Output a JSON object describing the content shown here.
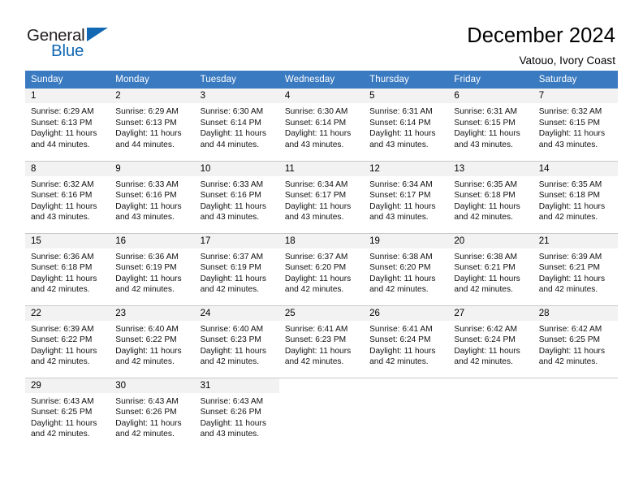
{
  "logo": {
    "word_general": "General",
    "word_blue": "Blue",
    "triangle_color": "#1268b3"
  },
  "header": {
    "title": "December 2024",
    "subtitle": "Vatouo, Ivory Coast"
  },
  "theme": {
    "header_row_bg": "#3a7ac0",
    "daynum_bg": "#f2f2f2",
    "grid_line": "#c9c9c9",
    "text": "#000000"
  },
  "weekdays": [
    "Sunday",
    "Monday",
    "Tuesday",
    "Wednesday",
    "Thursday",
    "Friday",
    "Saturday"
  ],
  "weeks": [
    [
      {
        "day": "1",
        "sunrise": "Sunrise: 6:29 AM",
        "sunset": "Sunset: 6:13 PM",
        "daylight1": "Daylight: 11 hours",
        "daylight2": "and 44 minutes."
      },
      {
        "day": "2",
        "sunrise": "Sunrise: 6:29 AM",
        "sunset": "Sunset: 6:13 PM",
        "daylight1": "Daylight: 11 hours",
        "daylight2": "and 44 minutes."
      },
      {
        "day": "3",
        "sunrise": "Sunrise: 6:30 AM",
        "sunset": "Sunset: 6:14 PM",
        "daylight1": "Daylight: 11 hours",
        "daylight2": "and 44 minutes."
      },
      {
        "day": "4",
        "sunrise": "Sunrise: 6:30 AM",
        "sunset": "Sunset: 6:14 PM",
        "daylight1": "Daylight: 11 hours",
        "daylight2": "and 43 minutes."
      },
      {
        "day": "5",
        "sunrise": "Sunrise: 6:31 AM",
        "sunset": "Sunset: 6:14 PM",
        "daylight1": "Daylight: 11 hours",
        "daylight2": "and 43 minutes."
      },
      {
        "day": "6",
        "sunrise": "Sunrise: 6:31 AM",
        "sunset": "Sunset: 6:15 PM",
        "daylight1": "Daylight: 11 hours",
        "daylight2": "and 43 minutes."
      },
      {
        "day": "7",
        "sunrise": "Sunrise: 6:32 AM",
        "sunset": "Sunset: 6:15 PM",
        "daylight1": "Daylight: 11 hours",
        "daylight2": "and 43 minutes."
      }
    ],
    [
      {
        "day": "8",
        "sunrise": "Sunrise: 6:32 AM",
        "sunset": "Sunset: 6:16 PM",
        "daylight1": "Daylight: 11 hours",
        "daylight2": "and 43 minutes."
      },
      {
        "day": "9",
        "sunrise": "Sunrise: 6:33 AM",
        "sunset": "Sunset: 6:16 PM",
        "daylight1": "Daylight: 11 hours",
        "daylight2": "and 43 minutes."
      },
      {
        "day": "10",
        "sunrise": "Sunrise: 6:33 AM",
        "sunset": "Sunset: 6:16 PM",
        "daylight1": "Daylight: 11 hours",
        "daylight2": "and 43 minutes."
      },
      {
        "day": "11",
        "sunrise": "Sunrise: 6:34 AM",
        "sunset": "Sunset: 6:17 PM",
        "daylight1": "Daylight: 11 hours",
        "daylight2": "and 43 minutes."
      },
      {
        "day": "12",
        "sunrise": "Sunrise: 6:34 AM",
        "sunset": "Sunset: 6:17 PM",
        "daylight1": "Daylight: 11 hours",
        "daylight2": "and 43 minutes."
      },
      {
        "day": "13",
        "sunrise": "Sunrise: 6:35 AM",
        "sunset": "Sunset: 6:18 PM",
        "daylight1": "Daylight: 11 hours",
        "daylight2": "and 42 minutes."
      },
      {
        "day": "14",
        "sunrise": "Sunrise: 6:35 AM",
        "sunset": "Sunset: 6:18 PM",
        "daylight1": "Daylight: 11 hours",
        "daylight2": "and 42 minutes."
      }
    ],
    [
      {
        "day": "15",
        "sunrise": "Sunrise: 6:36 AM",
        "sunset": "Sunset: 6:18 PM",
        "daylight1": "Daylight: 11 hours",
        "daylight2": "and 42 minutes."
      },
      {
        "day": "16",
        "sunrise": "Sunrise: 6:36 AM",
        "sunset": "Sunset: 6:19 PM",
        "daylight1": "Daylight: 11 hours",
        "daylight2": "and 42 minutes."
      },
      {
        "day": "17",
        "sunrise": "Sunrise: 6:37 AM",
        "sunset": "Sunset: 6:19 PM",
        "daylight1": "Daylight: 11 hours",
        "daylight2": "and 42 minutes."
      },
      {
        "day": "18",
        "sunrise": "Sunrise: 6:37 AM",
        "sunset": "Sunset: 6:20 PM",
        "daylight1": "Daylight: 11 hours",
        "daylight2": "and 42 minutes."
      },
      {
        "day": "19",
        "sunrise": "Sunrise: 6:38 AM",
        "sunset": "Sunset: 6:20 PM",
        "daylight1": "Daylight: 11 hours",
        "daylight2": "and 42 minutes."
      },
      {
        "day": "20",
        "sunrise": "Sunrise: 6:38 AM",
        "sunset": "Sunset: 6:21 PM",
        "daylight1": "Daylight: 11 hours",
        "daylight2": "and 42 minutes."
      },
      {
        "day": "21",
        "sunrise": "Sunrise: 6:39 AM",
        "sunset": "Sunset: 6:21 PM",
        "daylight1": "Daylight: 11 hours",
        "daylight2": "and 42 minutes."
      }
    ],
    [
      {
        "day": "22",
        "sunrise": "Sunrise: 6:39 AM",
        "sunset": "Sunset: 6:22 PM",
        "daylight1": "Daylight: 11 hours",
        "daylight2": "and 42 minutes."
      },
      {
        "day": "23",
        "sunrise": "Sunrise: 6:40 AM",
        "sunset": "Sunset: 6:22 PM",
        "daylight1": "Daylight: 11 hours",
        "daylight2": "and 42 minutes."
      },
      {
        "day": "24",
        "sunrise": "Sunrise: 6:40 AM",
        "sunset": "Sunset: 6:23 PM",
        "daylight1": "Daylight: 11 hours",
        "daylight2": "and 42 minutes."
      },
      {
        "day": "25",
        "sunrise": "Sunrise: 6:41 AM",
        "sunset": "Sunset: 6:23 PM",
        "daylight1": "Daylight: 11 hours",
        "daylight2": "and 42 minutes."
      },
      {
        "day": "26",
        "sunrise": "Sunrise: 6:41 AM",
        "sunset": "Sunset: 6:24 PM",
        "daylight1": "Daylight: 11 hours",
        "daylight2": "and 42 minutes."
      },
      {
        "day": "27",
        "sunrise": "Sunrise: 6:42 AM",
        "sunset": "Sunset: 6:24 PM",
        "daylight1": "Daylight: 11 hours",
        "daylight2": "and 42 minutes."
      },
      {
        "day": "28",
        "sunrise": "Sunrise: 6:42 AM",
        "sunset": "Sunset: 6:25 PM",
        "daylight1": "Daylight: 11 hours",
        "daylight2": "and 42 minutes."
      }
    ],
    [
      {
        "day": "29",
        "sunrise": "Sunrise: 6:43 AM",
        "sunset": "Sunset: 6:25 PM",
        "daylight1": "Daylight: 11 hours",
        "daylight2": "and 42 minutes."
      },
      {
        "day": "30",
        "sunrise": "Sunrise: 6:43 AM",
        "sunset": "Sunset: 6:26 PM",
        "daylight1": "Daylight: 11 hours",
        "daylight2": "and 42 minutes."
      },
      {
        "day": "31",
        "sunrise": "Sunrise: 6:43 AM",
        "sunset": "Sunset: 6:26 PM",
        "daylight1": "Daylight: 11 hours",
        "daylight2": "and 43 minutes."
      },
      {
        "day": "",
        "sunrise": "",
        "sunset": "",
        "daylight1": "",
        "daylight2": ""
      },
      {
        "day": "",
        "sunrise": "",
        "sunset": "",
        "daylight1": "",
        "daylight2": ""
      },
      {
        "day": "",
        "sunrise": "",
        "sunset": "",
        "daylight1": "",
        "daylight2": ""
      },
      {
        "day": "",
        "sunrise": "",
        "sunset": "",
        "daylight1": "",
        "daylight2": ""
      }
    ]
  ]
}
